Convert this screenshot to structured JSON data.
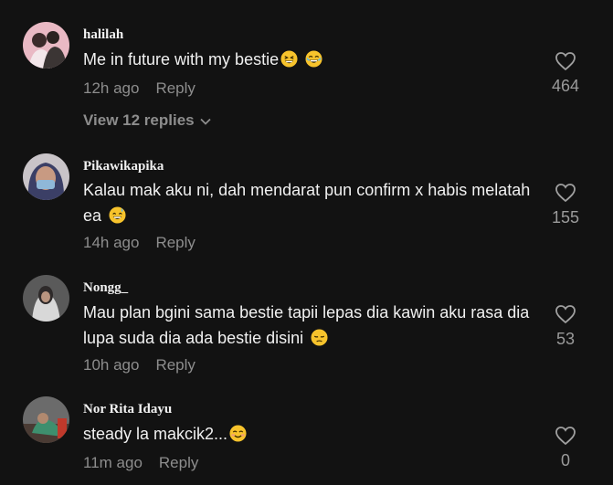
{
  "comments": [
    {
      "username": "halilah",
      "text": "Me in future with my bestie",
      "emojis": [
        "grinning-squint-face",
        "laughing-face"
      ],
      "time": "12h ago",
      "reply_label": "Reply",
      "likes": "464",
      "view_replies": "View 12 replies"
    },
    {
      "username": "Pikawikapika",
      "text": "Kalau mak aku ni, dah mendarat pun confirm x habis melatah ea",
      "emojis": [
        "grinning-sweat-face"
      ],
      "time": "14h ago",
      "reply_label": "Reply",
      "likes": "155"
    },
    {
      "username": "Nongg_",
      "text": "Mau plan bgini sama bestie tapii lepas dia kawin aku rasa dia lupa suda dia ada bestie disini",
      "emojis": [
        "pensive-face"
      ],
      "time": "10h ago",
      "reply_label": "Reply",
      "likes": "53"
    },
    {
      "username": "Nor Rita Idayu",
      "text": "steady la makcik2...",
      "emojis": [
        "smiling-face"
      ],
      "time": "11m ago",
      "reply_label": "Reply",
      "likes": "0"
    }
  ],
  "colors": {
    "background": "#121212",
    "text": "#f0f0f0",
    "muted": "#8d8d8d",
    "emoji_yellow": "#f7c32c"
  }
}
